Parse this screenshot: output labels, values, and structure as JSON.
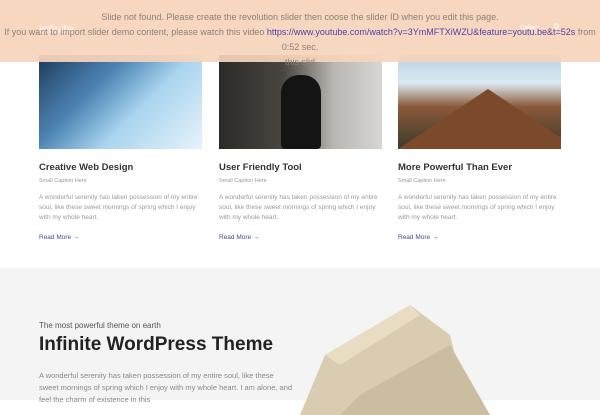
{
  "header": {
    "logo": "infinite",
    "nav_gallery": "Gallery",
    "search_icon": "search-icon"
  },
  "notice": {
    "line1": "Slide not found. Please create the revolution slider then coose the slider ID when you edit this page.",
    "line2_prefix": "If you want to import slider demo content, please watch this video",
    "link": "https://www.youtube.com/watch?v=3YmMFTXiWZU&feature=youtu.be&t=52s",
    "line2_suffix": "from 0:52 sec.",
    "line3": "this slid"
  },
  "cards": [
    {
      "title": "Creative Web Design",
      "caption": "Small Caption Here",
      "text": "A wonderful serenity has taken possession of my entire soul, like these sweet mornings of spring which I enjoy with my whole heart.",
      "more": "Read More →"
    },
    {
      "title": "User Friendly Tool",
      "caption": "Small Caption Here",
      "text": "A wonderful serenity has taken possession of my entire soul, like these sweet mornings of spring which I enjoy with my whole heart.",
      "more": "Read More →"
    },
    {
      "title": "More Powerful Than Ever",
      "caption": "Small Caption Here",
      "text": "A wonderful serenity has taken possession of my entire soul, like these sweet mornings of spring which I enjoy with my whole heart.",
      "more": "Read More →"
    }
  ],
  "promo": {
    "subtitle": "The most powerful theme on earth",
    "title": "Infinite WordPress Theme",
    "text": "A wonderful serenity has taken possession of my entire soul, like these sweet mornings of spring which I enjoy with my whole heart. I am alone, and feel the charm of existence in this"
  }
}
